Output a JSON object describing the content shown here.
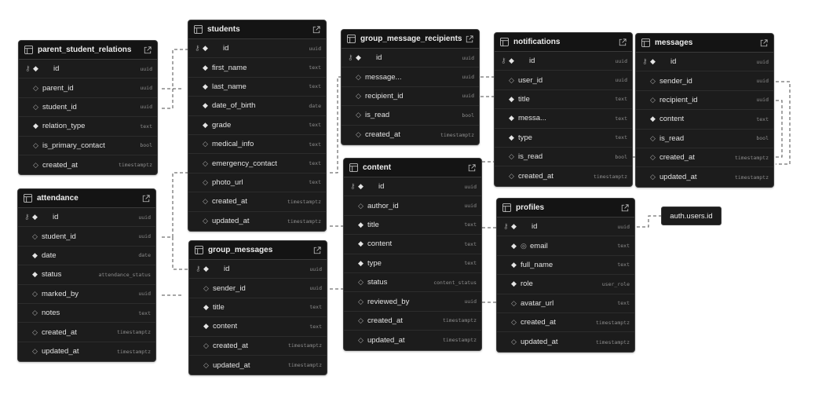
{
  "tables": [
    {
      "id": "parent_student_relations",
      "name": "parent_student_relations",
      "columns": [
        {
          "name": "id",
          "type": "uuid",
          "pk": true,
          "required": true
        },
        {
          "name": "parent_id",
          "type": "uuid",
          "required": false
        },
        {
          "name": "student_id",
          "type": "uuid",
          "required": false
        },
        {
          "name": "relation_type",
          "type": "text",
          "required": true
        },
        {
          "name": "is_primary_contact",
          "type": "bool",
          "required": false
        },
        {
          "name": "created_at",
          "type": "timestamptz",
          "required": false
        }
      ]
    },
    {
      "id": "attendance",
      "name": "attendance",
      "columns": [
        {
          "name": "id",
          "type": "uuid",
          "pk": true,
          "required": true
        },
        {
          "name": "student_id",
          "type": "uuid",
          "required": false
        },
        {
          "name": "date",
          "type": "date",
          "required": true
        },
        {
          "name": "status",
          "type": "attendance_status",
          "required": true
        },
        {
          "name": "marked_by",
          "type": "uuid",
          "required": false
        },
        {
          "name": "notes",
          "type": "text",
          "required": false
        },
        {
          "name": "created_at",
          "type": "timestamptz",
          "required": false
        },
        {
          "name": "updated_at",
          "type": "timestamptz",
          "required": false
        }
      ]
    },
    {
      "id": "students",
      "name": "students",
      "columns": [
        {
          "name": "id",
          "type": "uuid",
          "pk": true,
          "required": true
        },
        {
          "name": "first_name",
          "type": "text",
          "required": true
        },
        {
          "name": "last_name",
          "type": "text",
          "required": true
        },
        {
          "name": "date_of_birth",
          "type": "date",
          "required": true
        },
        {
          "name": "grade",
          "type": "text",
          "required": true
        },
        {
          "name": "medical_info",
          "type": "text",
          "required": false
        },
        {
          "name": "emergency_contact",
          "type": "text",
          "required": false
        },
        {
          "name": "photo_url",
          "type": "text",
          "required": false
        },
        {
          "name": "created_at",
          "type": "timestamptz",
          "required": false
        },
        {
          "name": "updated_at",
          "type": "timestamptz",
          "required": false
        }
      ]
    },
    {
      "id": "group_messages",
      "name": "group_messages",
      "columns": [
        {
          "name": "id",
          "type": "uuid",
          "pk": true,
          "required": true
        },
        {
          "name": "sender_id",
          "type": "uuid",
          "required": false
        },
        {
          "name": "title",
          "type": "text",
          "required": true
        },
        {
          "name": "content",
          "type": "text",
          "required": true
        },
        {
          "name": "created_at",
          "type": "timestamptz",
          "required": false
        },
        {
          "name": "updated_at",
          "type": "timestamptz",
          "required": false
        }
      ]
    },
    {
      "id": "group_message_recipients",
      "name": "group_message_recipients",
      "columns": [
        {
          "name": "id",
          "type": "uuid",
          "pk": true,
          "required": true
        },
        {
          "name": "message...",
          "type": "uuid",
          "required": false
        },
        {
          "name": "recipient_id",
          "type": "uuid",
          "required": false
        },
        {
          "name": "is_read",
          "type": "bool",
          "required": false
        },
        {
          "name": "created_at",
          "type": "timestamptz",
          "required": false
        }
      ]
    },
    {
      "id": "content",
      "name": "content",
      "columns": [
        {
          "name": "id",
          "type": "uuid",
          "pk": true,
          "required": true
        },
        {
          "name": "author_id",
          "type": "uuid",
          "required": false
        },
        {
          "name": "title",
          "type": "text",
          "required": true
        },
        {
          "name": "content",
          "type": "text",
          "required": true
        },
        {
          "name": "type",
          "type": "text",
          "required": true
        },
        {
          "name": "status",
          "type": "content_status",
          "required": false
        },
        {
          "name": "reviewed_by",
          "type": "uuid",
          "required": false
        },
        {
          "name": "created_at",
          "type": "timestamptz",
          "required": false
        },
        {
          "name": "updated_at",
          "type": "timestamptz",
          "required": false
        }
      ]
    },
    {
      "id": "notifications",
      "name": "notifications",
      "columns": [
        {
          "name": "id",
          "type": "uuid",
          "pk": true,
          "required": true
        },
        {
          "name": "user_id",
          "type": "uuid",
          "required": false
        },
        {
          "name": "title",
          "type": "text",
          "required": true
        },
        {
          "name": "messa...",
          "type": "text",
          "required": true
        },
        {
          "name": "type",
          "type": "text",
          "required": true
        },
        {
          "name": "is_read",
          "type": "bool",
          "required": false
        },
        {
          "name": "created_at",
          "type": "timestamptz",
          "required": false
        }
      ]
    },
    {
      "id": "profiles",
      "name": "profiles",
      "columns": [
        {
          "name": "id",
          "type": "uuid",
          "pk": true,
          "required": true
        },
        {
          "name": "email",
          "type": "text",
          "required": true,
          "unique": true
        },
        {
          "name": "full_name",
          "type": "text",
          "required": true
        },
        {
          "name": "role",
          "type": "user_role",
          "required": true
        },
        {
          "name": "avatar_url",
          "type": "text",
          "required": false
        },
        {
          "name": "created_at",
          "type": "timestamptz",
          "required": false
        },
        {
          "name": "updated_at",
          "type": "timestamptz",
          "required": false
        }
      ]
    },
    {
      "id": "messages",
      "name": "messages",
      "columns": [
        {
          "name": "id",
          "type": "uuid",
          "pk": true,
          "required": true
        },
        {
          "name": "sender_id",
          "type": "uuid",
          "required": false
        },
        {
          "name": "recipient_id",
          "type": "uuid",
          "required": false
        },
        {
          "name": "content",
          "type": "text",
          "required": true
        },
        {
          "name": "is_read",
          "type": "bool",
          "required": false
        },
        {
          "name": "created_at",
          "type": "timestamptz",
          "required": false
        },
        {
          "name": "updated_at",
          "type": "timestamptz",
          "required": false
        }
      ]
    }
  ],
  "external": {
    "label": "auth.users.id"
  },
  "colors": {
    "background": "#ffffff",
    "table_bg": "#1c1c1c",
    "header_bg": "#141414",
    "border": "#3a3a3a",
    "text": "#e2e2e2",
    "muted": "#8d8d8d",
    "link": "#555555"
  },
  "icons": {
    "table": "table-icon",
    "open": "external-link-icon",
    "primary_key": "key-icon",
    "required": "filled-diamond-icon",
    "nullable": "hollow-diamond-icon",
    "unique": "fingerprint-icon"
  }
}
